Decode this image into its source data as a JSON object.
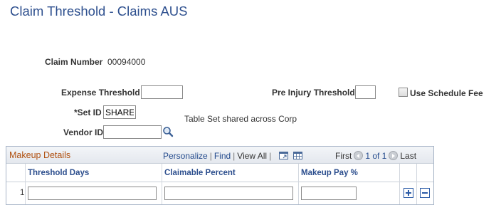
{
  "page": {
    "title": "Claim Threshold - Claims AUS"
  },
  "claim": {
    "label": "Claim Number",
    "value": "00094000"
  },
  "form": {
    "expense_threshold": {
      "label": "Expense Threshold",
      "value": ""
    },
    "pre_injury_threshold": {
      "label": "Pre Injury Threshold",
      "value": ""
    },
    "use_schedule_fee": {
      "label": "Use Schedule Fee",
      "checked": false
    },
    "set_id": {
      "label": "*Set ID",
      "value": "SHARE",
      "description": "Table Set shared across Corp"
    },
    "vendor_id": {
      "label": "Vendor ID",
      "value": ""
    }
  },
  "grid": {
    "title": "Makeup Details",
    "tools": {
      "personalize": "Personalize",
      "find": "Find",
      "view_all": "View All",
      "sep": "|"
    },
    "nav": {
      "first": "First",
      "count": "1 of 1",
      "last": "Last"
    },
    "columns": [
      "Threshold Days",
      "Claimable Percent",
      "Makeup Pay %"
    ],
    "rows": [
      {
        "num": "1",
        "threshold_days": "",
        "claimable_percent": "",
        "makeup_pay": ""
      }
    ]
  },
  "icons": {
    "lookup": "magnifier-icon",
    "zoom": "zoom-grid-icon",
    "download": "download-spreadsheet-icon",
    "add_row": "plus-icon",
    "delete_row": "minus-icon"
  },
  "colors": {
    "title": "#2d4f8e",
    "grid_title": "#b05010",
    "link": "#244b8d"
  }
}
